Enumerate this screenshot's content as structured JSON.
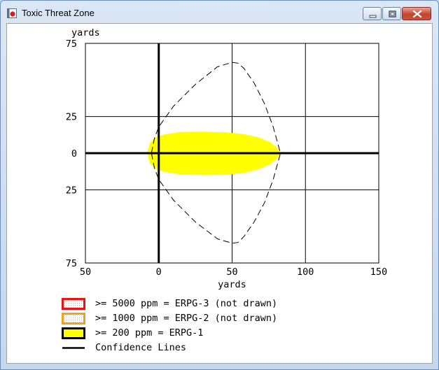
{
  "window": {
    "title": "Toxic Threat Zone",
    "controls": [
      "minimize",
      "maximize",
      "close"
    ]
  },
  "colors": {
    "zone_fill": "#ffff00",
    "erpg3_border": "#ee1111",
    "erpg2_border": "#f2a020",
    "erpg1_border": "#000000",
    "window_frame": "#c8d9ee"
  },
  "chart_data": {
    "type": "area",
    "x_unit_label": "yards",
    "y_unit_label": "yards",
    "xlim": [
      -50,
      150
    ],
    "ylim": [
      -75,
      75
    ],
    "x_ticks": [
      {
        "value": -50,
        "label": "50"
      },
      {
        "value": 0,
        "label": "0"
      },
      {
        "value": 50,
        "label": "50"
      },
      {
        "value": 100,
        "label": "100"
      },
      {
        "value": 150,
        "label": "150"
      }
    ],
    "y_ticks": [
      {
        "value": 75,
        "label": "75"
      },
      {
        "value": 25,
        "label": "25"
      },
      {
        "value": 0,
        "label": "0"
      },
      {
        "value": -25,
        "label": "25"
      },
      {
        "value": -75,
        "label": "75"
      }
    ],
    "grid": true,
    "zone_erpg1": {
      "upper": [
        [
          -8,
          0
        ],
        [
          -6,
          7
        ],
        [
          -2,
          11
        ],
        [
          5,
          13
        ],
        [
          15,
          14.5
        ],
        [
          30,
          14.7
        ],
        [
          45,
          14.3
        ],
        [
          58,
          13
        ],
        [
          68,
          10.8
        ],
        [
          76,
          7.5
        ],
        [
          81,
          3.5
        ],
        [
          83,
          0
        ]
      ],
      "lower": [
        [
          83,
          0
        ],
        [
          81,
          -3.5
        ],
        [
          76,
          -7.5
        ],
        [
          68,
          -11
        ],
        [
          58,
          -13.5
        ],
        [
          45,
          -14.8
        ],
        [
          30,
          -15
        ],
        [
          15,
          -14.5
        ],
        [
          5,
          -13
        ],
        [
          -2,
          -11
        ],
        [
          -6,
          -7
        ],
        [
          -8,
          0
        ]
      ]
    },
    "confidence_lines": [
      [
        [
          -5,
          0
        ],
        [
          -3,
          10
        ],
        [
          0,
          18
        ],
        [
          10,
          32
        ],
        [
          25,
          47
        ],
        [
          40,
          59
        ],
        [
          50,
          62
        ],
        [
          54,
          61.5
        ],
        [
          58,
          58
        ],
        [
          65,
          48
        ],
        [
          72,
          34
        ],
        [
          78,
          18
        ],
        [
          83,
          0
        ]
      ],
      [
        [
          -5,
          0
        ],
        [
          -3,
          -10
        ],
        [
          0,
          -18
        ],
        [
          10,
          -32
        ],
        [
          25,
          -47
        ],
        [
          40,
          -58.5
        ],
        [
          50,
          -61.5
        ],
        [
          54,
          -61
        ],
        [
          58,
          -57
        ],
        [
          65,
          -47
        ],
        [
          72,
          -34
        ],
        [
          78,
          -18
        ],
        [
          83,
          0
        ]
      ]
    ]
  },
  "legend": [
    {
      "label": ">= 5000 ppm = ERPG-3 (not drawn)",
      "border": "#ee1111",
      "fill": "dotted-white"
    },
    {
      "label": ">= 1000 ppm = ERPG-2 (not drawn)",
      "border": "#f2a020",
      "fill": "dotted-white"
    },
    {
      "label": ">= 200 ppm = ERPG-1",
      "border": "#000000",
      "fill": "yellow"
    },
    {
      "label": "Confidence Lines",
      "border": "",
      "fill": "line"
    }
  ]
}
